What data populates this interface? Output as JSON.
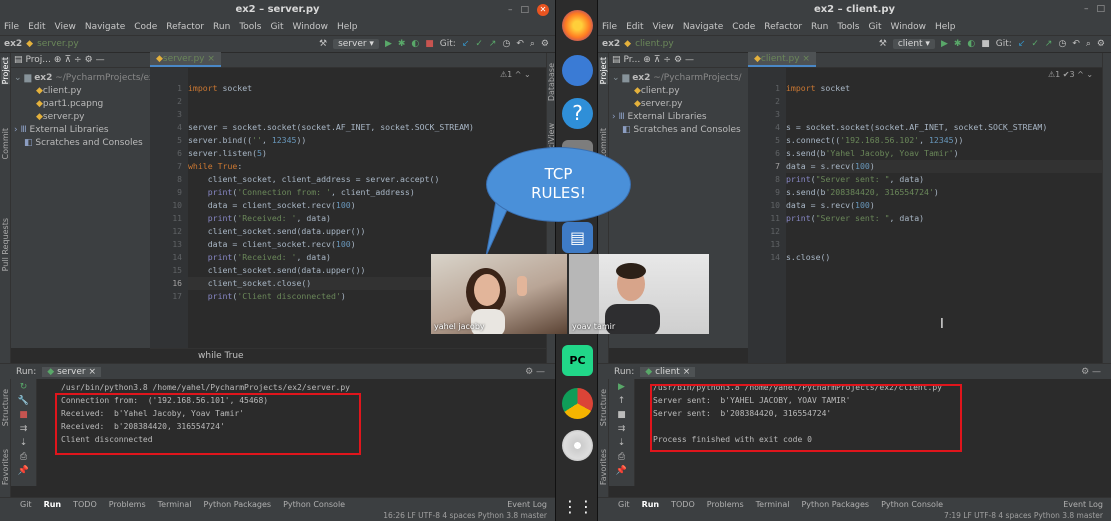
{
  "server_window": {
    "title": "ex2 – server.py",
    "menu": [
      "File",
      "Edit",
      "View",
      "Navigate",
      "Code",
      "Refactor",
      "Run",
      "Tools",
      "Git",
      "Window",
      "Help"
    ],
    "nav": {
      "project": "ex2",
      "file": "server.py",
      "run_config": "server ▾",
      "git": "Git:"
    },
    "project_panel": {
      "header": "Proj...",
      "tree": [
        {
          "label": "ex2",
          "detail": "~/PycharmProjects/ex",
          "kind": "folder"
        },
        {
          "label": "client.py",
          "kind": "py"
        },
        {
          "label": "part1.pcapng",
          "kind": "py"
        },
        {
          "label": "server.py",
          "kind": "py"
        },
        {
          "label": "External Libraries",
          "kind": "lib"
        },
        {
          "label": "Scratches and Consoles",
          "kind": "scratch"
        }
      ]
    },
    "side_labels": [
      "Project",
      "Commit",
      "Pull Requests"
    ],
    "right_labels": [
      "Database",
      "SciView"
    ],
    "editor_tab": "server.py",
    "inspection": "⚠1 ^ ⌄",
    "line_numbers": [
      "1",
      "2",
      "3",
      "4",
      "5",
      "6",
      "7",
      "8",
      "9",
      "10",
      "11",
      "12",
      "13",
      "14",
      "15",
      "16",
      "17"
    ],
    "code_lines": [
      "import socket",
      "",
      "",
      "server = socket.socket(socket.AF_INET, socket.SOCK_STREAM)",
      "server.bind(('', 12345))",
      "server.listen(5)",
      "while True:",
      "    client_socket, client_address = server.accept()",
      "    print('Connection from: ', client_address)",
      "    data = client_socket.recv(100)",
      "    print('Received: ', data)",
      "    client_socket.send(data.upper())",
      "    data = client_socket.recv(100)",
      "    print('Received: ', data)",
      "    client_socket.send(data.upper())",
      "    client_socket.close()",
      "    print('Client disconnected')"
    ],
    "breadcrumb": "while True",
    "run_label": "Run:",
    "run_tab": "server",
    "console": [
      "/usr/bin/python3.8 /home/yahel/PycharmProjects/ex2/server.py",
      "Connection from:  ('192.168.56.101', 45468)",
      "Received:  b'Yahel Jacoby, Yoav Tamir'",
      "Received:  b'208384420, 316554724'",
      "Client disconnected"
    ],
    "bottom_tabs": [
      "Git",
      "Run",
      "TODO",
      "Problems",
      "Terminal",
      "Python Packages",
      "Python Console"
    ],
    "event_log": "Event Log",
    "status": "16:26  LF  UTF-8  4 spaces  Python 3.8  master"
  },
  "client_window": {
    "title": "ex2 – client.py",
    "menu": [
      "File",
      "Edit",
      "View",
      "Navigate",
      "Code",
      "Refactor",
      "Run",
      "Tools",
      "Git",
      "Window",
      "Help"
    ],
    "nav": {
      "project": "ex2",
      "file": "client.py",
      "run_config": "client ▾",
      "git": "Git:"
    },
    "project_panel": {
      "header": "Pr...",
      "tree": [
        {
          "label": "ex2",
          "detail": "~/PycharmProjects/",
          "kind": "folder"
        },
        {
          "label": "client.py",
          "kind": "py"
        },
        {
          "label": "server.py",
          "kind": "py"
        },
        {
          "label": "External Libraries",
          "kind": "lib"
        },
        {
          "label": "Scratches and Consoles",
          "kind": "scratch"
        }
      ]
    },
    "editor_tab": "client.py",
    "inspection": "⚠1 ✔3 ^ ⌄",
    "line_numbers": [
      "1",
      "2",
      "3",
      "4",
      "5",
      "6",
      "7",
      "8",
      "9",
      "10",
      "11",
      "12",
      "13",
      "14"
    ],
    "code_lines": [
      "import socket",
      "",
      "",
      "s = socket.socket(socket.AF_INET, socket.SOCK_STREAM)",
      "s.connect(('192.168.56.102', 12345))",
      "s.send(b'Yahel Jacoby, Yoav Tamir')",
      "data = s.recv(100)",
      "print(\"Server sent: \", data)",
      "s.send(b'208384420, 316554724')",
      "data = s.recv(100)",
      "print(\"Server sent: \", data)",
      "",
      "",
      "s.close()"
    ],
    "run_label": "Run:",
    "run_tab": "client",
    "console": [
      "/usr/bin/python3.8 /home/yahel/PycharmProjects/ex2/client.py",
      "Server sent:  b'YAHEL JACOBY, YOAV TAMIR'",
      "Server sent:  b'208384420, 316554724'",
      "",
      "Process finished with exit code 0"
    ],
    "bottom_tabs": [
      "Git",
      "Run",
      "TODO",
      "Problems",
      "Terminal",
      "Python Packages",
      "Python Console"
    ],
    "event_log": "Event Log",
    "status": "7:19  LF  UTF-8  4 spaces  Python 3.8  master"
  },
  "overlay": {
    "bubble_line1": "TCP",
    "bubble_line2": "RULES!",
    "video_left_name": "yahel jacoby",
    "video_right_name": "yoav tamir"
  },
  "dock_apps": [
    "firefox-icon",
    "thunderbird-icon",
    "help-icon",
    "files-icon",
    "terminal-icon",
    "docs-icon",
    "pycharm-icon",
    "chrome-icon",
    "disc-icon",
    "apps-grid-icon"
  ],
  "colors": {
    "keyword": "#cc7832",
    "string": "#6a8759",
    "number": "#6897bb",
    "highlight_box": "#e0151c",
    "bubble": "#4a90d9"
  }
}
